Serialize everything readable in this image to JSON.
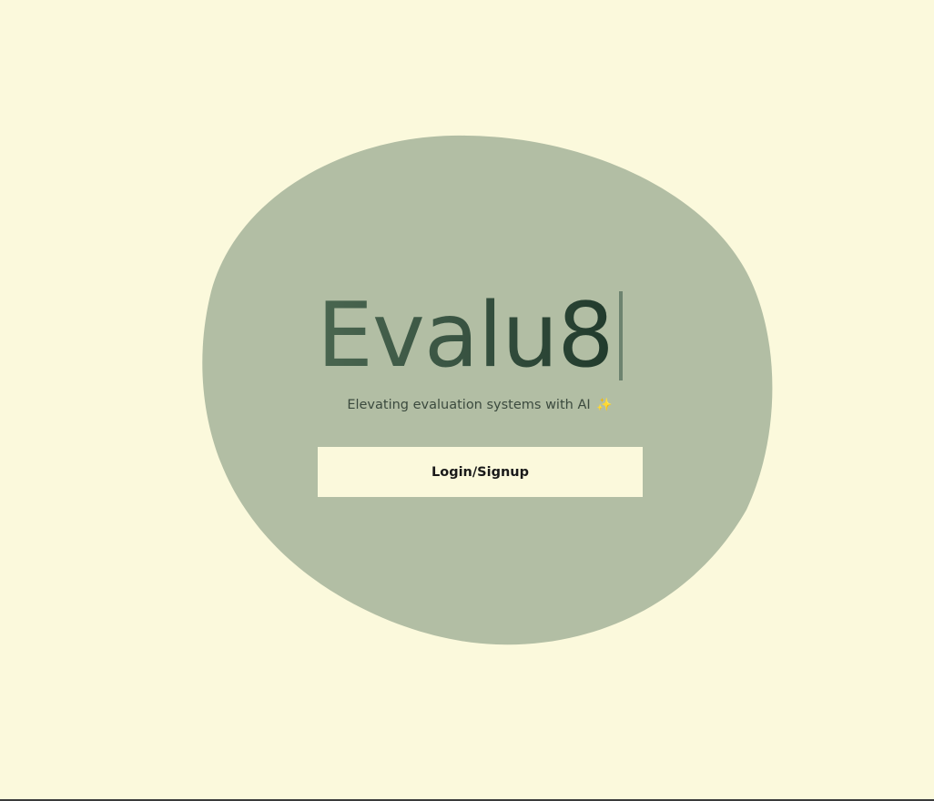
{
  "colors": {
    "background": "#fbf9dc",
    "blob": "#b2bea4",
    "title_dark": "#213a2c",
    "title_light": "#4a6650",
    "button_bg": "#fbf9dc",
    "sparkle": "#e8c24a"
  },
  "hero": {
    "title": "Evalu8",
    "tagline": "Elevating evaluation systems with AI",
    "tagline_icon": "sparkles-icon",
    "tagline_emoji": "✨"
  },
  "cta": {
    "label": "Login/Signup"
  }
}
